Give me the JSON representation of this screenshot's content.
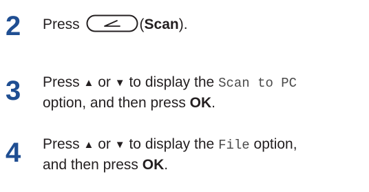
{
  "steps": [
    {
      "number": "2",
      "press": "Press",
      "paren_open": "(",
      "scan_label": "Scan",
      "paren_close": ").",
      "icon": "scan-button-icon"
    },
    {
      "number": "3",
      "press": "Press",
      "up_arrow": "▲",
      "or": "or",
      "down_arrow": "▼",
      "to_display": "to display the",
      "option_code": "Scan to PC",
      "line2_start": "option, and then press",
      "ok_label": "OK",
      "period": "."
    },
    {
      "number": "4",
      "press": "Press",
      "up_arrow": "▲",
      "or": "or",
      "down_arrow": "▼",
      "to_display": "to display the",
      "option_code": "File",
      "option_suffix": "option,",
      "line2_start": "and then press",
      "ok_label": "OK",
      "period": "."
    }
  ],
  "colors": {
    "step_number": "#1f4e92",
    "text": "#231f20"
  }
}
